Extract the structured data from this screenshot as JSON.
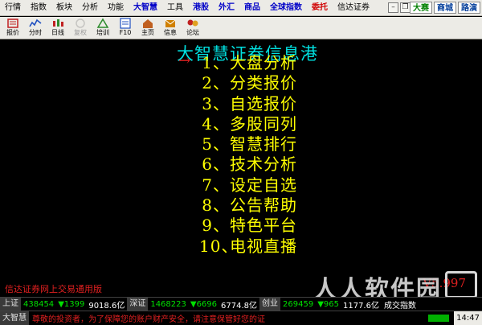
{
  "menu": {
    "items": [
      {
        "label": "行情",
        "style": ""
      },
      {
        "label": "指数",
        "style": ""
      },
      {
        "label": "板块",
        "style": ""
      },
      {
        "label": "分析",
        "style": ""
      },
      {
        "label": "功能",
        "style": ""
      },
      {
        "label": "大智慧",
        "style": "hl"
      },
      {
        "label": "工具",
        "style": ""
      },
      {
        "label": "港股",
        "style": "hl"
      },
      {
        "label": "外汇",
        "style": "hl"
      },
      {
        "label": "商品",
        "style": "hl"
      },
      {
        "label": "全球指数",
        "style": "hl"
      },
      {
        "label": "委托",
        "style": "red"
      },
      {
        "label": "信达证券",
        "style": ""
      }
    ],
    "top_links": [
      "大赛",
      "商城",
      "路演"
    ]
  },
  "toolbar": {
    "items": [
      {
        "label": "报价",
        "icon": "quote-icon",
        "color": "#c02020"
      },
      {
        "label": "分时",
        "icon": "timeshare-icon",
        "color": "#2050c0"
      },
      {
        "label": "日线",
        "icon": "kline-icon",
        "color": "#c02020"
      },
      {
        "label": "复权",
        "icon": "restore-rights-icon",
        "color": "#808080",
        "disabled": true
      },
      {
        "label": "培训",
        "icon": "training-icon",
        "color": "#2a8a2a"
      },
      {
        "label": "F10",
        "icon": "f10-icon",
        "color": "#2050c0"
      },
      {
        "label": "主页",
        "icon": "home-icon",
        "color": "#c06020"
      },
      {
        "label": "信息",
        "icon": "info-icon",
        "color": "#d08000"
      },
      {
        "label": "论坛",
        "icon": "forum-icon",
        "color": "#c02020"
      }
    ]
  },
  "main": {
    "title": "大智慧证券信息港",
    "arrow": "→",
    "entries": [
      {
        "num": "1、",
        "label": "大盘分析"
      },
      {
        "num": "2、",
        "label": "分类报价"
      },
      {
        "num": "3、",
        "label": "自选报价"
      },
      {
        "num": "4、",
        "label": "多股同列"
      },
      {
        "num": "5、",
        "label": "智慧排行"
      },
      {
        "num": "6、",
        "label": "技术分析"
      },
      {
        "num": "7、",
        "label": "设定自选"
      },
      {
        "num": "8、",
        "label": "公告帮助"
      },
      {
        "num": "9、",
        "label": "特色平台"
      },
      {
        "num": "10、",
        "label": "电视直播"
      }
    ],
    "version": "V5.997",
    "footer_label": "信达证券网上交易通用版",
    "watermark": "人人软件园"
  },
  "indexbar": {
    "sh_name": "上证",
    "sh_value": "438454",
    "sh_change": "▼1399",
    "sh_amount": "9018.6亿",
    "sz_name": "深证",
    "sz_value": "1468223",
    "sz_change": "▼6696",
    "sz_amount": "6774.8亿",
    "cy_name": "创业",
    "cy_value": "269459",
    "cy_change": "▼965",
    "cy_amount": "1177.6亿",
    "tail": "成交指数"
  },
  "statusbar": {
    "name": "大智慧",
    "ticker": "尊敬的投资者，为了保障您的账户财产安全，请注意保管好您的证",
    "time": "14:47"
  },
  "colors": {
    "title": "#00e0e0",
    "entries": "#ffff00",
    "accent_red": "#e02020",
    "index_green": "#00e000"
  }
}
